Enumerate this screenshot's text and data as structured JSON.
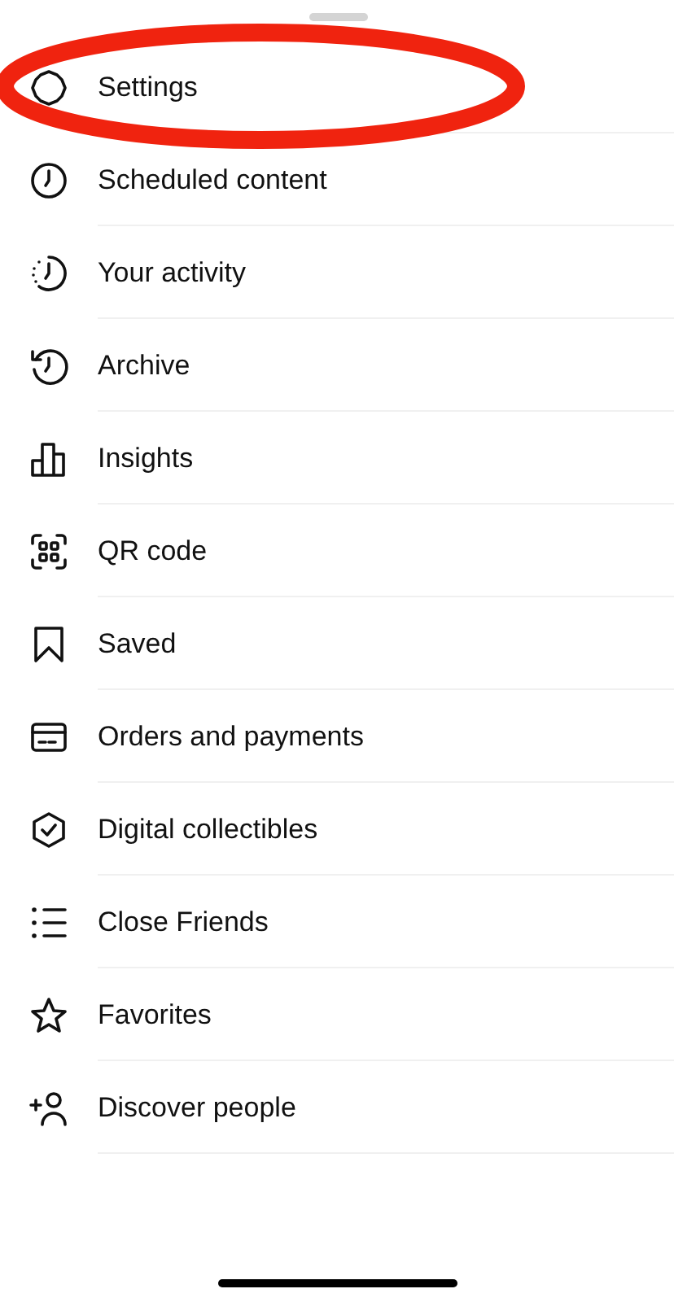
{
  "menu_items": [
    {
      "label": "Settings",
      "highlighted": true
    },
    {
      "label": "Scheduled content",
      "highlighted": false
    },
    {
      "label": "Your activity",
      "highlighted": false
    },
    {
      "label": "Archive",
      "highlighted": false
    },
    {
      "label": "Insights",
      "highlighted": false
    },
    {
      "label": "QR code",
      "highlighted": false
    },
    {
      "label": "Saved",
      "highlighted": false
    },
    {
      "label": "Orders and payments",
      "highlighted": false
    },
    {
      "label": "Digital collectibles",
      "highlighted": false
    },
    {
      "label": "Close Friends",
      "highlighted": false
    },
    {
      "label": "Favorites",
      "highlighted": false
    },
    {
      "label": "Discover people",
      "highlighted": false
    }
  ]
}
